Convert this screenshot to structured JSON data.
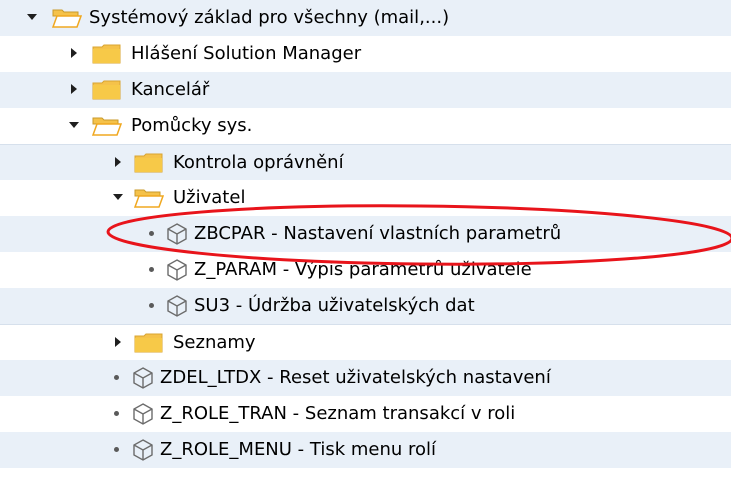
{
  "tree": {
    "items": [
      {
        "label": "Systémový  základ pro všechny (mail,...)",
        "type": "folder",
        "state": "expanded",
        "level": 0
      },
      {
        "label": "Hlášení Solution Manager",
        "type": "folder",
        "state": "collapsed",
        "level": 1
      },
      {
        "label": "Kancelář",
        "type": "folder",
        "state": "collapsed",
        "level": 1
      },
      {
        "label": "Pomůcky sys.",
        "type": "folder",
        "state": "expanded",
        "level": 1
      },
      {
        "label": "Kontrola oprávnění",
        "type": "folder",
        "state": "collapsed",
        "level": 2
      },
      {
        "label": "Uživatel",
        "type": "folder",
        "state": "expanded",
        "level": 2
      },
      {
        "label": "ZBCPAR - Nastavení vlastních parametrů",
        "type": "transaction",
        "level": 3,
        "highlighted": true
      },
      {
        "label": "Z_PARAM - Výpis parametrů uživatele",
        "type": "transaction",
        "level": 3
      },
      {
        "label": "SU3 - Údržba uživatelských dat",
        "type": "transaction",
        "level": 3
      },
      {
        "label": "Seznamy",
        "type": "folder",
        "state": "collapsed",
        "level": 2
      },
      {
        "label": "ZDEL_LTDX - Reset uživatelských nastavení",
        "type": "transaction",
        "level": 2
      },
      {
        "label": "Z_ROLE_TRAN - Seznam transakcí v roli",
        "type": "transaction",
        "level": 2
      },
      {
        "label": "Z_ROLE_MENU - Tisk menu rolí",
        "type": "transaction",
        "level": 2
      }
    ]
  },
  "colors": {
    "row_alt_background": "#e9f0f8",
    "folder_fill": "#f5c24a",
    "highlight_ellipse": "#e8141b",
    "icon_gray": "#6b6b6b"
  }
}
